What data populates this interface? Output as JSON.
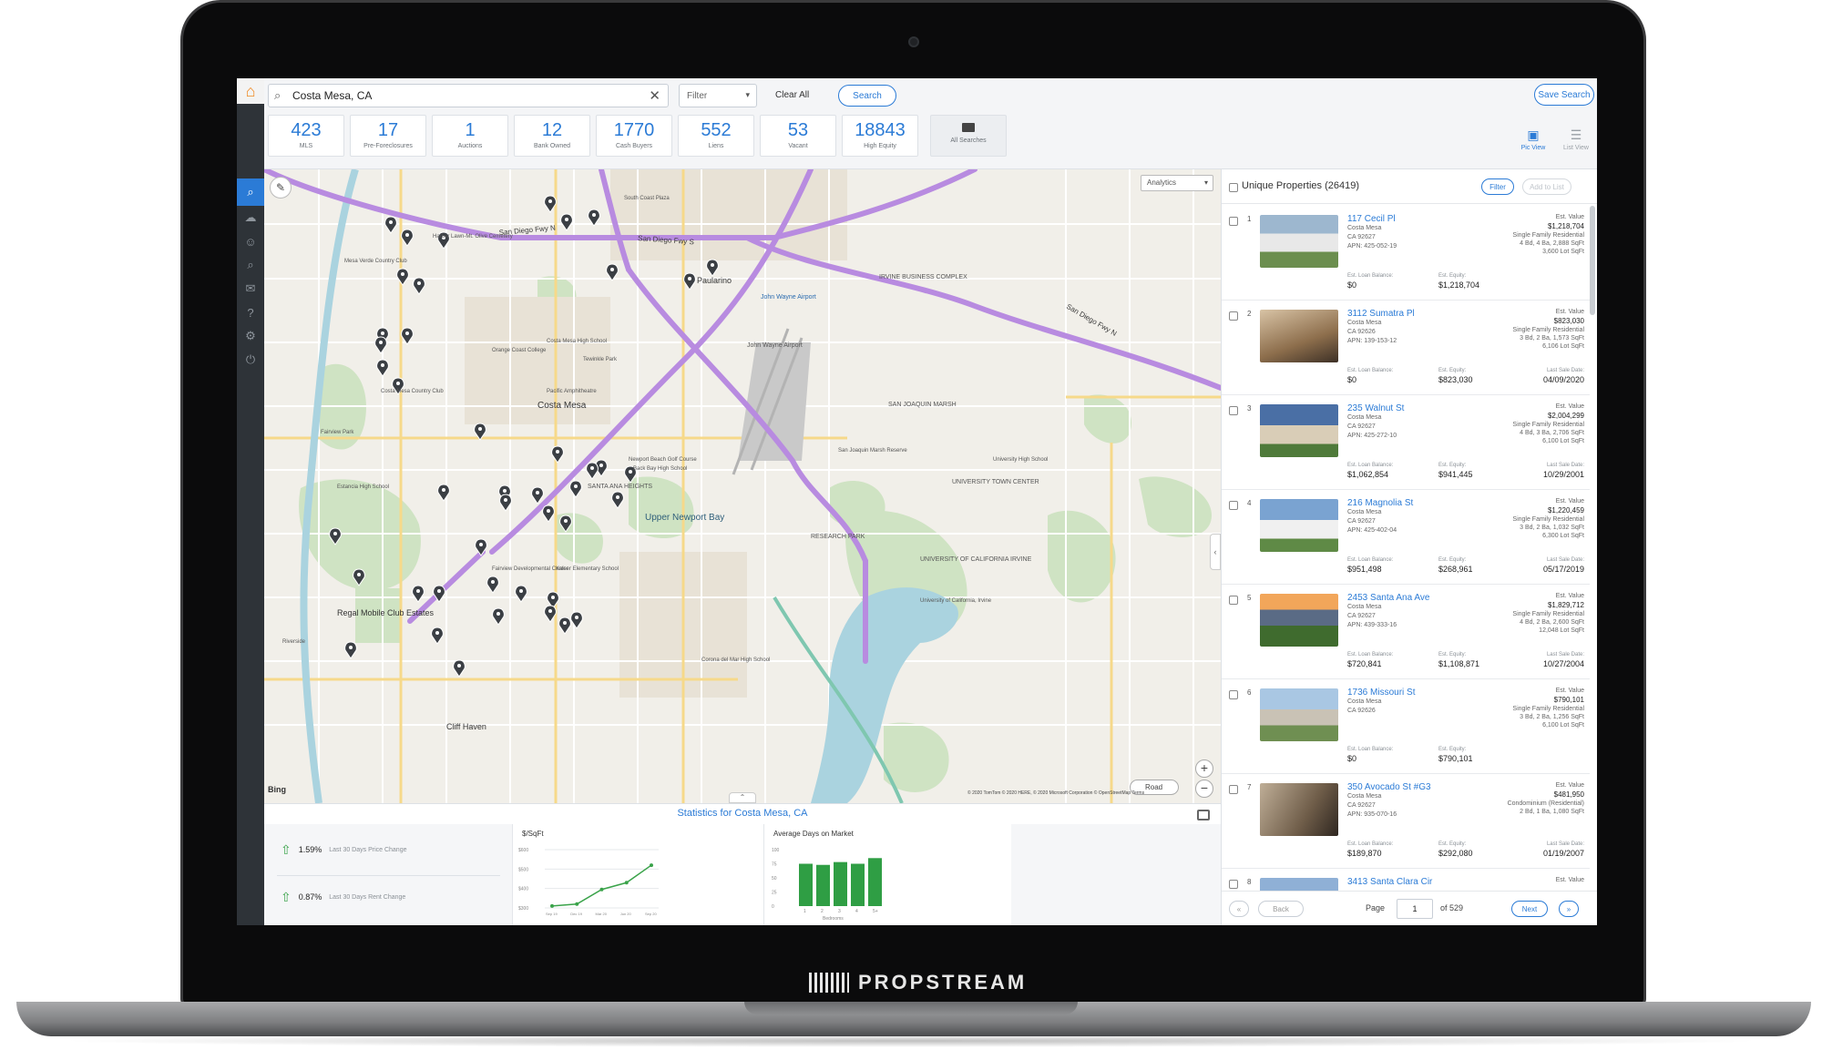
{
  "brand": {
    "name": "PROPSTREAM"
  },
  "search": {
    "value": "Costa Mesa, CA",
    "filter_label": "Filter",
    "clear_label": "Clear All",
    "search_label": "Search",
    "save_label": "Save Search"
  },
  "tiles": [
    {
      "count": "423",
      "label": "MLS"
    },
    {
      "count": "17",
      "label": "Pre-Foreclosures"
    },
    {
      "count": "1",
      "label": "Auctions"
    },
    {
      "count": "12",
      "label": "Bank Owned"
    },
    {
      "count": "1770",
      "label": "Cash Buyers"
    },
    {
      "count": "552",
      "label": "Liens"
    },
    {
      "count": "53",
      "label": "Vacant"
    },
    {
      "count": "18843",
      "label": "High Equity"
    }
  ],
  "all_searches_label": "All Searches",
  "views": {
    "pic_label": "Pic View",
    "list_label": "List View"
  },
  "map": {
    "analytics_label": "Analytics",
    "road_label": "Road",
    "bing_label": "Bing",
    "copyright": "© 2020 TomTom © 2020 HERE, © 2020 Microsoft Corporation © OpenStreetMap Terms",
    "labels": [
      {
        "id": "lbl-sandiego1",
        "text": "San Diego Fwy N"
      },
      {
        "id": "lbl-sandiego2",
        "text": "San Diego Fwy S"
      },
      {
        "id": "lbl-sandiego3",
        "text": "San Diego Fwy N"
      },
      {
        "id": "lbl-costamesa",
        "text": "Costa Mesa"
      },
      {
        "id": "lbl-paularino",
        "text": "Paularino"
      },
      {
        "id": "lbl-airport",
        "text": "John Wayne Airport"
      },
      {
        "id": "lbl-jw",
        "text": "John Wayne Airport"
      },
      {
        "id": "lbl-newport",
        "text": "Upper Newport Bay"
      },
      {
        "id": "lbl-santaana",
        "text": "SANTA ANA HEIGHTS"
      },
      {
        "id": "lbl-regal",
        "text": "Regal Mobile Club Estates"
      },
      {
        "id": "lbl-cliff",
        "text": "Cliff Haven"
      },
      {
        "id": "lbl-sjmarsh",
        "text": "SAN JOAQUIN MARSH"
      },
      {
        "id": "lbl-irvine",
        "text": "IRVINE BUSINESS COMPLEX"
      },
      {
        "id": "lbl-research",
        "text": "RESEARCH PARK"
      },
      {
        "id": "lbl-uci",
        "text": "UNIVERSITY OF CALIFORNIA IRVINE"
      },
      {
        "id": "lbl-utc",
        "text": "UNIVERSITY TOWN CENTER"
      },
      {
        "id": "lbl-mesaverde",
        "text": "Mesa Verde Country Club"
      },
      {
        "id": "lbl-occ",
        "text": "Orange Coast College"
      },
      {
        "id": "lbl-southcoast",
        "text": "South Coast Plaza"
      },
      {
        "id": "lbl-fairview",
        "text": "Fairview Park"
      },
      {
        "id": "lbl-costamesacc",
        "text": "Costa Mesa Country Club"
      },
      {
        "id": "lbl-estancia",
        "text": "Estancia High School"
      },
      {
        "id": "lbl-harbor",
        "text": "Harbor Lawn-Mt. Olive Cemetery"
      },
      {
        "id": "lbl-teewinkle",
        "text": "Tewinkle Park"
      },
      {
        "id": "lbl-pacificamph",
        "text": "Pacific Amphitheatre"
      },
      {
        "id": "lbl-mesaverdehigh",
        "text": "Costa Mesa High School"
      },
      {
        "id": "lbl-newportgolf",
        "text": "Newport Beach Golf Course"
      },
      {
        "id": "lbl-backbay",
        "text": "Back Bay High School"
      },
      {
        "id": "lbl-sjmarsh2",
        "text": "San Joaquin Marsh Reserve"
      },
      {
        "id": "lbl-ucirvine",
        "text": "University of California, Irvine"
      },
      {
        "id": "lbl-univhigh",
        "text": "University High School"
      },
      {
        "id": "lbl-fairviewdev",
        "text": "Fairview Developmental Center"
      },
      {
        "id": "lbl-kaiser",
        "text": "Kaiser Elementary School"
      },
      {
        "id": "lbl-coronadelmar",
        "text": "Corona del Mar High School"
      },
      {
        "id": "lbl-riverside",
        "text": "Riverside"
      }
    ]
  },
  "stats": {
    "title": "Statistics for Costa Mesa, CA",
    "price_change": {
      "value": "1.59%",
      "label": "Last 30 Days Price Change"
    },
    "rent_change": {
      "value": "0.87%",
      "label": "Last 30 Days Rent Change"
    },
    "sqft_title": "$/SqFt",
    "dom_title": "Average Days on Market",
    "dom_xlabel": "Bedrooms"
  },
  "chart_data": [
    {
      "type": "line",
      "title": "$/SqFt",
      "x": [
        "Sep 19",
        "Dec 19",
        "Mar 20",
        "Jun 20",
        "Sep 20"
      ],
      "y_ticks": [
        "$300",
        "$400",
        "$500",
        "$600"
      ],
      "series": [
        {
          "values": [
            310,
            320,
            395,
            430,
            520
          ]
        }
      ]
    },
    {
      "type": "bar",
      "title": "Average Days on Market",
      "xlabel": "Bedrooms",
      "categories": [
        "1",
        "2",
        "3",
        "4",
        "5+"
      ],
      "y_ticks": [
        "0",
        "25",
        "50",
        "75",
        "100"
      ],
      "values": [
        75,
        73,
        78,
        75,
        85
      ]
    }
  ],
  "list": {
    "title": "Unique Properties (26419)",
    "filter_label": "Filter",
    "add_label": "Add to List",
    "items": [
      {
        "idx": "1",
        "address": "117 Cecil Pl",
        "city": "Costa Mesa",
        "zip": "CA 92627",
        "apn": "APN: 425-052-19",
        "value_label": "Est. Value",
        "value": "$1,218,704",
        "type": "Single Family Residential",
        "beds": "4 Bd, 4 Ba, 2,888 SqFt",
        "lot": "3,600 Lot SqFt",
        "loan_label": "Est. Loan Balance:",
        "loan": "$0",
        "equity_label": "Est. Equity:",
        "equity": "$1,218,704",
        "sale_label": "",
        "sale": ""
      },
      {
        "idx": "2",
        "address": "3112 Sumatra Pl",
        "city": "Costa Mesa",
        "zip": "CA 92626",
        "apn": "APN: 139-153-12",
        "value_label": "Est. Value",
        "value": "$823,030",
        "type": "Single Family Residential",
        "beds": "3 Bd, 2 Ba, 1,573 SqFt",
        "lot": "6,106 Lot SqFt",
        "loan_label": "Est. Loan Balance:",
        "loan": "$0",
        "equity_label": "Est. Equity:",
        "equity": "$823,030",
        "sale_label": "Last Sale Date:",
        "sale": "04/09/2020"
      },
      {
        "idx": "3",
        "address": "235 Walnut St",
        "city": "Costa Mesa",
        "zip": "CA 92627",
        "apn": "APN: 425-272-10",
        "value_label": "Est. Value",
        "value": "$2,004,299",
        "type": "Single Family Residential",
        "beds": "4 Bd, 3 Ba, 2,706 SqFt",
        "lot": "6,100 Lot SqFt",
        "loan_label": "Est. Loan Balance:",
        "loan": "$1,062,854",
        "equity_label": "Est. Equity:",
        "equity": "$941,445",
        "sale_label": "Last Sale Date:",
        "sale": "10/29/2001"
      },
      {
        "idx": "4",
        "address": "216 Magnolia St",
        "city": "Costa Mesa",
        "zip": "CA 92627",
        "apn": "APN: 425-402-04",
        "value_label": "Est. Value",
        "value": "$1,220,459",
        "type": "Single Family Residential",
        "beds": "3 Bd, 2 Ba, 1,032 SqFt",
        "lot": "6,300 Lot SqFt",
        "loan_label": "Est. Loan Balance:",
        "loan": "$951,498",
        "equity_label": "Est. Equity:",
        "equity": "$268,961",
        "sale_label": "Last Sale Date:",
        "sale": "05/17/2019"
      },
      {
        "idx": "5",
        "address": "2453 Santa Ana Ave",
        "city": "Costa Mesa",
        "zip": "CA 92627",
        "apn": "APN: 439-333-16",
        "value_label": "Est. Value",
        "value": "$1,829,712",
        "type": "Single Family Residential",
        "beds": "4 Bd, 2 Ba, 2,600 SqFt",
        "lot": "12,048 Lot SqFt",
        "loan_label": "Est. Loan Balance:",
        "loan": "$720,841",
        "equity_label": "Est. Equity:",
        "equity": "$1,108,871",
        "sale_label": "Last Sale Date:",
        "sale": "10/27/2004"
      },
      {
        "idx": "6",
        "address": "1736 Missouri St",
        "city": "Costa Mesa",
        "zip": "CA 92626",
        "apn": "",
        "value_label": "Est. Value",
        "value": "$790,101",
        "type": "Single Family Residential",
        "beds": "3 Bd, 2 Ba, 1,256 SqFt",
        "lot": "6,100 Lot SqFt",
        "loan_label": "Est. Loan Balance:",
        "loan": "$0",
        "equity_label": "Est. Equity:",
        "equity": "$790,101",
        "sale_label": "",
        "sale": ""
      },
      {
        "idx": "7",
        "address": "350 Avocado St #G3",
        "city": "Costa Mesa",
        "zip": "CA 92627",
        "apn": "APN: 935-070-16",
        "value_label": "Est. Value",
        "value": "$481,950",
        "type": "Condominium (Residential)",
        "beds": "2 Bd, 1 Ba, 1,080 SqFt",
        "lot": "",
        "loan_label": "Est. Loan Balance:",
        "loan": "$189,870",
        "equity_label": "Est. Equity:",
        "equity": "$292,080",
        "sale_label": "Last Sale Date:",
        "sale": "01/19/2007"
      },
      {
        "idx": "8",
        "address": "3413 Santa Clara Cir",
        "city": "",
        "zip": "",
        "apn": "",
        "value_label": "Est. Value",
        "value": "",
        "type": "",
        "beds": "",
        "lot": "",
        "loan_label": "",
        "loan": "",
        "equity_label": "",
        "equity": "",
        "sale_label": "",
        "sale": ""
      }
    ]
  },
  "pager": {
    "back_label": "Back",
    "next_label": "Next",
    "page_label": "Page",
    "page_value": "1",
    "of_label": "of 529",
    "first": "«",
    "last": "»"
  }
}
